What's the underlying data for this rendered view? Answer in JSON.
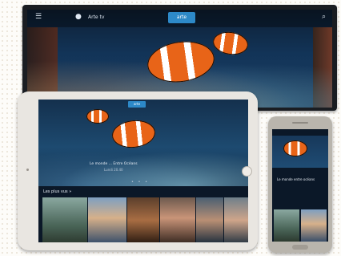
{
  "tv": {
    "logo_text": "arte",
    "label": "Arte tv",
    "menu_icon": "menu-icon",
    "search_icon": "search-icon"
  },
  "tablet": {
    "logo_text": "arte",
    "hero_title": "Le monde ... Entre Océans",
    "hero_subtitle": "Lundi 20.40",
    "carousel_dots": "• • •",
    "row_title": "Les plus vus »"
  },
  "phone": {
    "caption": "Le monde entre océans"
  },
  "colors": {
    "brand": "#2d89c8",
    "clownfish_orange": "#e86418",
    "screen_bg": "#0b1828"
  }
}
